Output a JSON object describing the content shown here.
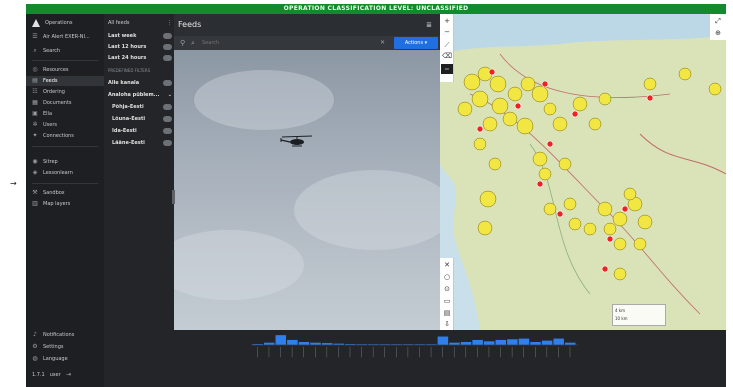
{
  "banner": {
    "text": "OPERATION CLASSIFICATION LEVEL: UNCLASSIFIED"
  },
  "sidebar": {
    "app_name": "Operations",
    "workspace": "Air Alert EXER-NI...",
    "search_label": "Search",
    "nav": [
      {
        "label": "Resources",
        "icon": "resources-icon"
      },
      {
        "label": "Feeds",
        "icon": "feeds-icon",
        "active": true
      },
      {
        "label": "Ordering",
        "icon": "ordering-icon"
      },
      {
        "label": "Documents",
        "icon": "documents-icon"
      },
      {
        "label": "Ella",
        "icon": "chat-icon"
      },
      {
        "label": "Users",
        "icon": "users-icon"
      },
      {
        "label": "Connections",
        "icon": "connections-icon"
      }
    ],
    "tools": [
      {
        "label": "Sitrep",
        "icon": "sitrep-icon"
      },
      {
        "label": "Lessonlearn",
        "icon": "lessons-icon"
      }
    ],
    "map_items": [
      {
        "label": "Sandbox",
        "icon": "sandbox-icon"
      },
      {
        "label": "Map layers",
        "icon": "layers-icon"
      }
    ],
    "bottom": [
      {
        "label": "Notifications",
        "icon": "bell-icon"
      },
      {
        "label": "Settings",
        "icon": "gear-icon"
      },
      {
        "label": "Language",
        "icon": "globe-icon"
      }
    ],
    "version": "1.7.1",
    "user": "user"
  },
  "filters": {
    "header": "All feeds",
    "time_filters": [
      {
        "label": "Last week",
        "count": ""
      },
      {
        "label": "Last 12 hours",
        "count": ""
      },
      {
        "label": "Last 24 hours",
        "count": ""
      }
    ],
    "section_label": "Predefined filters",
    "group_filters": [
      {
        "label": "Alle kanala",
        "count": "",
        "sub": false
      },
      {
        "label": "Analoha püblem...",
        "count": "",
        "sub": false
      },
      {
        "label": "Põhja-Eesti",
        "count": "",
        "sub": true
      },
      {
        "label": "Lõuna-Eesti",
        "count": "",
        "sub": true
      },
      {
        "label": "Ida-Eesti",
        "count": "",
        "sub": true
      },
      {
        "label": "Lääne-Eesti",
        "count": "",
        "sub": true
      }
    ]
  },
  "feeds": {
    "title": "Feeds",
    "search_placeholder": "Search",
    "actions_label": "Actions"
  },
  "map": {
    "scale_line1": "4 km",
    "scale_line2": "10 km"
  },
  "timeline": {
    "bars": [
      0.05,
      0.15,
      0.7,
      0.35,
      0.2,
      0.15,
      0.12,
      0.08,
      0.05,
      0.04,
      0.03,
      0.03,
      0.03,
      0.03,
      0.03,
      0.03,
      0.6,
      0.15,
      0.2,
      0.35,
      0.25,
      0.35,
      0.4,
      0.45,
      0.2,
      0.3,
      0.45,
      0.15
    ]
  }
}
